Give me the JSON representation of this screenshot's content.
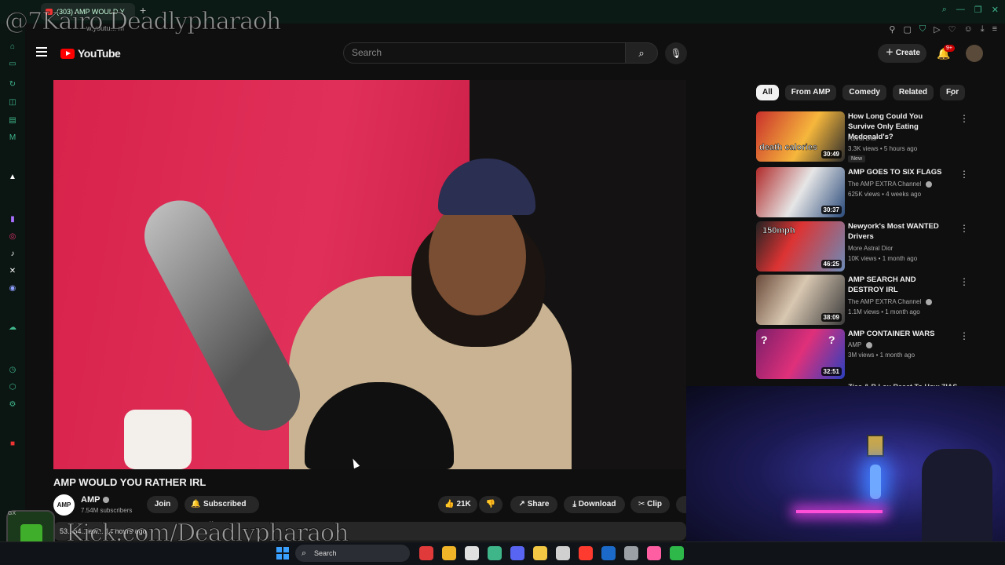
{
  "browser": {
    "tab_title": "(303) AMP WOULD Y",
    "new_tab_symbol": "+",
    "url_ghost": "w.youtu... m"
  },
  "overlays": {
    "streamer_handle": "@7Kairo Deadlypharaoh",
    "kick_url": "Kick.com/Deadlypharaoh",
    "gx_label": "GX"
  },
  "header": {
    "logo_text": "YouTube",
    "search_placeholder": "Search",
    "create_label": "Create",
    "notification_count": "9+"
  },
  "video": {
    "title": "AMP WOULD YOU RATHER IRL",
    "channel_name": "AMP",
    "channel_avatar_text": "AMP",
    "subscribers": "7.54M subscribers",
    "join_label": "Join",
    "subscribed_label": "Subscribed",
    "like_count": "21K",
    "share_label": "Share",
    "download_label": "Download",
    "clip_label": "Clip",
    "description_snippet": "53...54...iew... 14 hours ago"
  },
  "chips": [
    "All",
    "From AMP",
    "Comedy",
    "Related",
    "For"
  ],
  "recommendations": [
    {
      "title": "How Long Could You Survive Only Eating Mcdonald's?",
      "channel": "Astral Dior",
      "meta": "3.3K views • 5 hours ago",
      "badge": "New",
      "duration": "30:49",
      "thumb_text": "death calories"
    },
    {
      "title": "AMP GOES TO SIX FLAGS",
      "channel": "The AMP EXTRA Channel",
      "meta": "625K views • 4 weeks ago",
      "duration": "30:37"
    },
    {
      "title": "Newyork's Most WANTED Drivers",
      "channel": "More Astral Dior",
      "meta": "10K views • 1 month ago",
      "duration": "46:25",
      "thumb_text": "150mph"
    },
    {
      "title": "AMP SEARCH AND DESTROY IRL",
      "channel": "The AMP EXTRA Channel",
      "meta": "1.1M views • 1 month ago",
      "duration": "38:09"
    },
    {
      "title": "AMP CONTAINER WARS",
      "channel": "AMP",
      "meta": "3M views • 1 month ago",
      "duration": "32:51"
    }
  ],
  "partial_recommendation": "Zias & B Lou React To How ZIAS",
  "taskbar": {
    "search_label": "Search",
    "app_colors": [
      "#e03a3a",
      "#f0b429",
      "#e0e0e0",
      "#3fb58a",
      "#5865f2",
      "#f2c744",
      "#d0d0d0",
      "#ff3b30",
      "#1b6ac9",
      "#9aa0a6",
      "#ff5fa2",
      "#2eb84a"
    ]
  }
}
